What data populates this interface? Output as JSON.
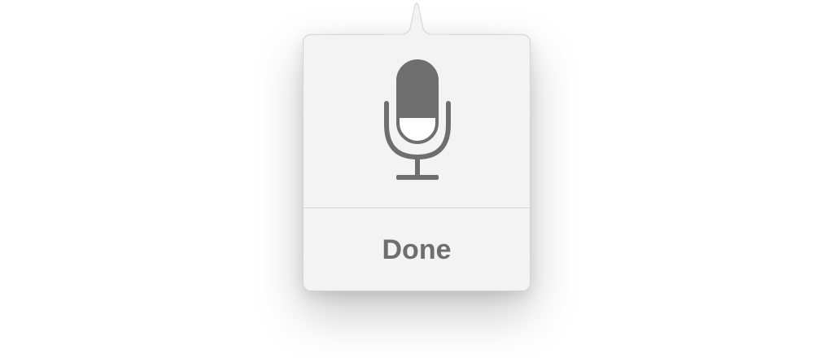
{
  "popover": {
    "mic_icon": "microphone-icon",
    "input_level": 0.3,
    "done_label": "Done"
  },
  "colors": {
    "icon": "#6e6e6e",
    "level_fill": "#ffffff",
    "panel": "#f3f3f3",
    "divider": "#d6d6d6",
    "text": "#6e6e6e"
  }
}
